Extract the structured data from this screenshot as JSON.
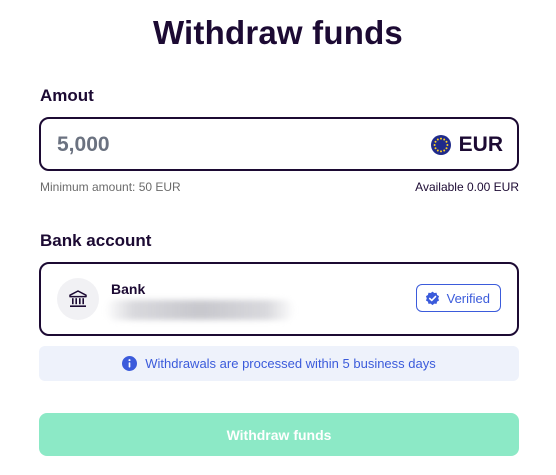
{
  "page": {
    "title": "Withdraw funds"
  },
  "amount": {
    "label": "Amout",
    "value": "5,000",
    "currency": "EUR",
    "currency_icon": "eu-flag-icon",
    "minimum_hint": "Minimum amount: 50 EUR",
    "available_hint": "Available 0.00 EUR"
  },
  "bank_account": {
    "label": "Bank account",
    "bank_name": "Bank",
    "bank_icon": "bank-icon",
    "status": "Verified",
    "status_icon": "verified-check-icon"
  },
  "info": {
    "icon": "info-icon",
    "text": "Withdrawals are processed within 5 business days"
  },
  "submit": {
    "label": "Withdraw funds",
    "enabled": false
  },
  "colors": {
    "primary_text": "#1c0a33",
    "accent_blue": "#3b5bdb",
    "info_background": "#eef2fb",
    "button_background": "#8ce9c6"
  }
}
